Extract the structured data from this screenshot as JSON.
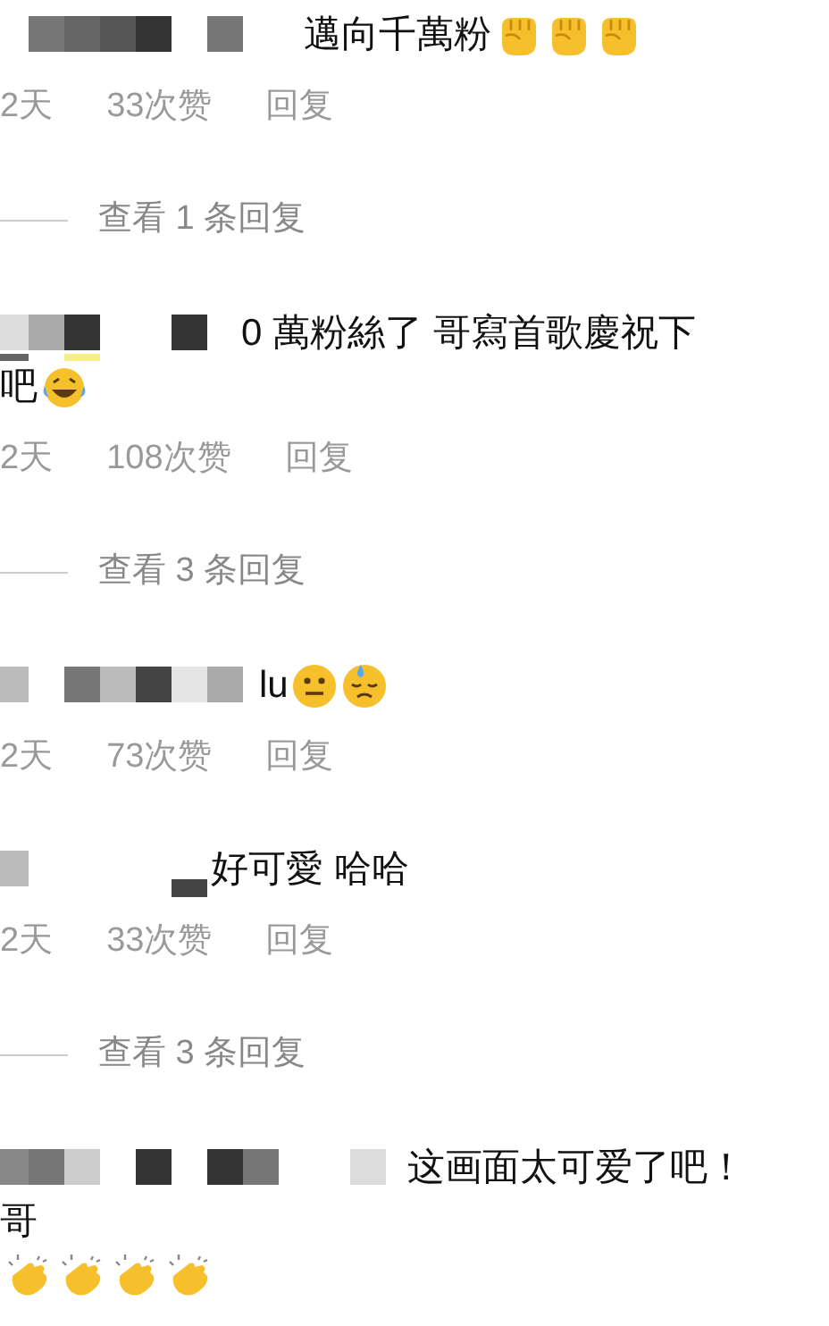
{
  "comments": [
    {
      "lines": [
        {
          "text": "邁向千萬粉",
          "emojis": [
            {
              "kind": "fist"
            },
            {
              "kind": "fist"
            },
            {
              "kind": "fist"
            }
          ]
        }
      ],
      "meta": {
        "time": "2天",
        "likes": "33次赞",
        "reply": "回复"
      },
      "view_replies": "查看 1 条回复"
    },
    {
      "lines": [
        {
          "text": "0 萬粉絲了 哥寫首歌慶祝下"
        },
        {
          "text": "吧",
          "emojis": [
            {
              "kind": "laughing"
            }
          ]
        }
      ],
      "meta": {
        "time": "2天",
        "likes": "108次赞",
        "reply": "回复"
      },
      "view_replies": "查看 3 条回复"
    },
    {
      "lines": [
        {
          "text": "lu",
          "emojis": [
            {
              "kind": "neutral"
            },
            {
              "kind": "sweat"
            }
          ]
        }
      ],
      "meta": {
        "time": "2天",
        "likes": "73次赞",
        "reply": "回复"
      }
    },
    {
      "lines": [
        {
          "text": "好可愛 哈哈"
        }
      ],
      "meta": {
        "time": "2天",
        "likes": "33次赞",
        "reply": "回复"
      },
      "view_replies": "查看 3 条回复"
    },
    {
      "lines": [
        {
          "text": "这画面太可爱了吧！"
        },
        {
          "text": "哥"
        },
        {
          "emojis": [
            {
              "kind": "clap"
            },
            {
              "kind": "clap"
            },
            {
              "kind": "clap"
            },
            {
              "kind": "clap"
            }
          ]
        }
      ]
    }
  ]
}
